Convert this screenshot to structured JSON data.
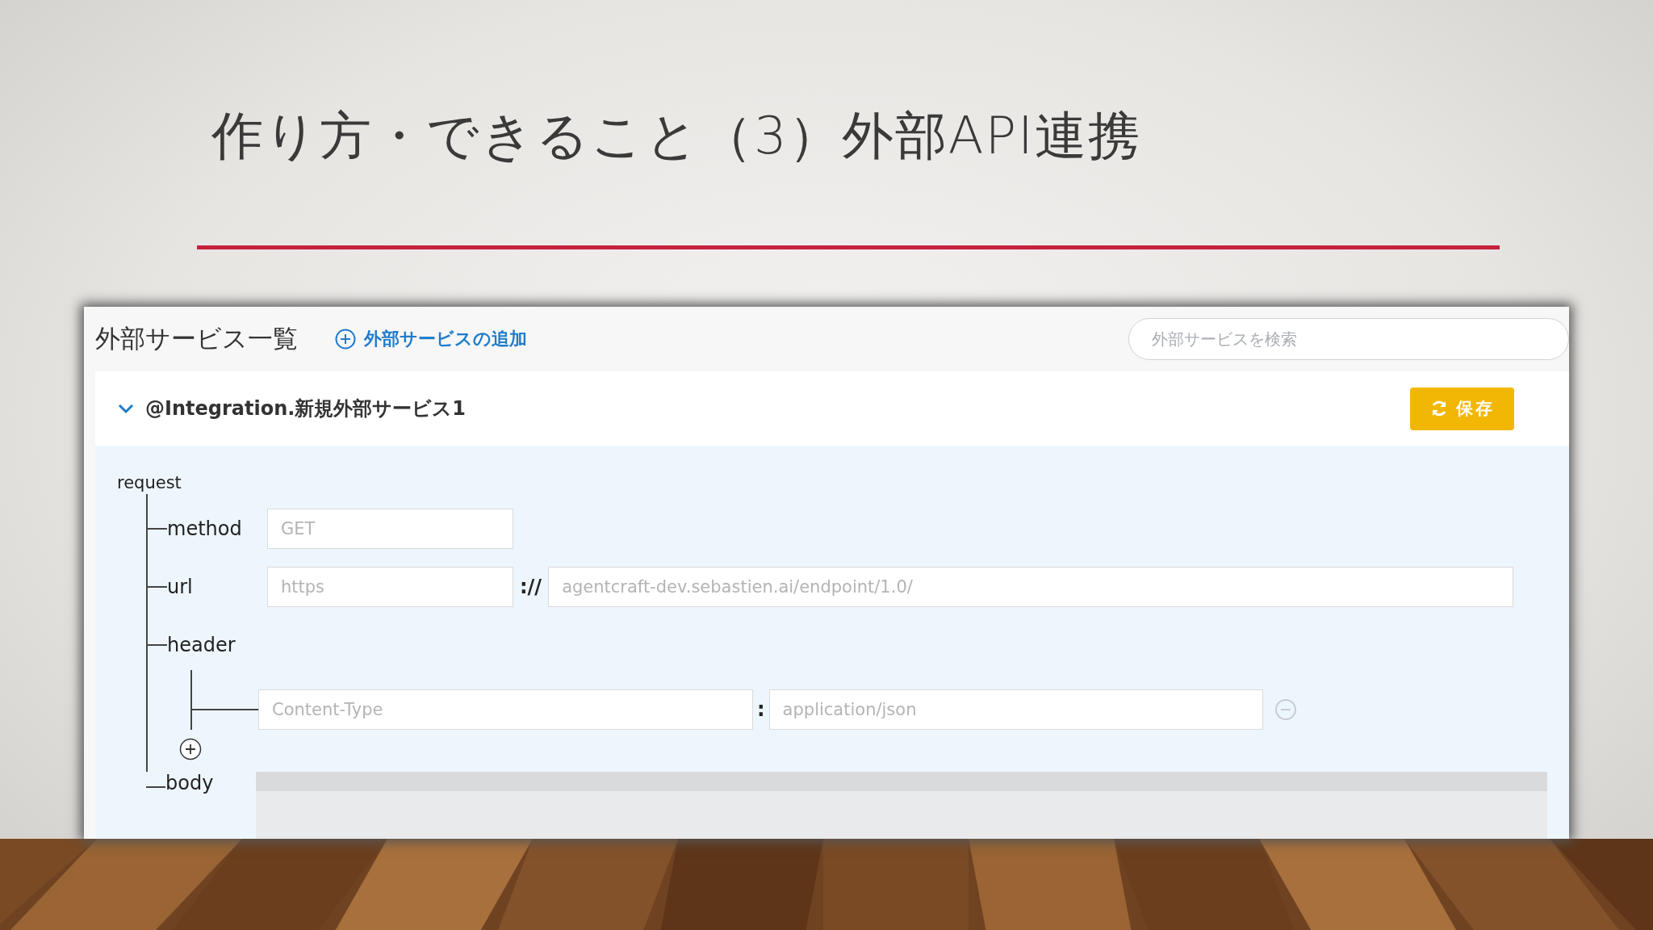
{
  "slide": {
    "title": "作り方・できること（3）外部API連携"
  },
  "app": {
    "title": "外部サービス一覧",
    "add_link": "外部サービスの追加",
    "search": {
      "placeholder": "外部サービスを検索"
    },
    "service": {
      "name": "@Integration.新規外部サービス1",
      "expanded": true,
      "save_button": "保存",
      "request": {
        "label": "request",
        "method": {
          "label": "method",
          "placeholder": "GET"
        },
        "url": {
          "label": "url",
          "scheme_placeholder": "https",
          "separator": "://",
          "host_placeholder": "agentcraft-dev.sebastien.ai/endpoint/1.0/"
        },
        "header": {
          "label": "header",
          "rows": [
            {
              "key_placeholder": "Content-Type",
              "separator": ":",
              "value_placeholder": "application/json"
            }
          ]
        },
        "body": {
          "label": "body"
        }
      }
    }
  }
}
